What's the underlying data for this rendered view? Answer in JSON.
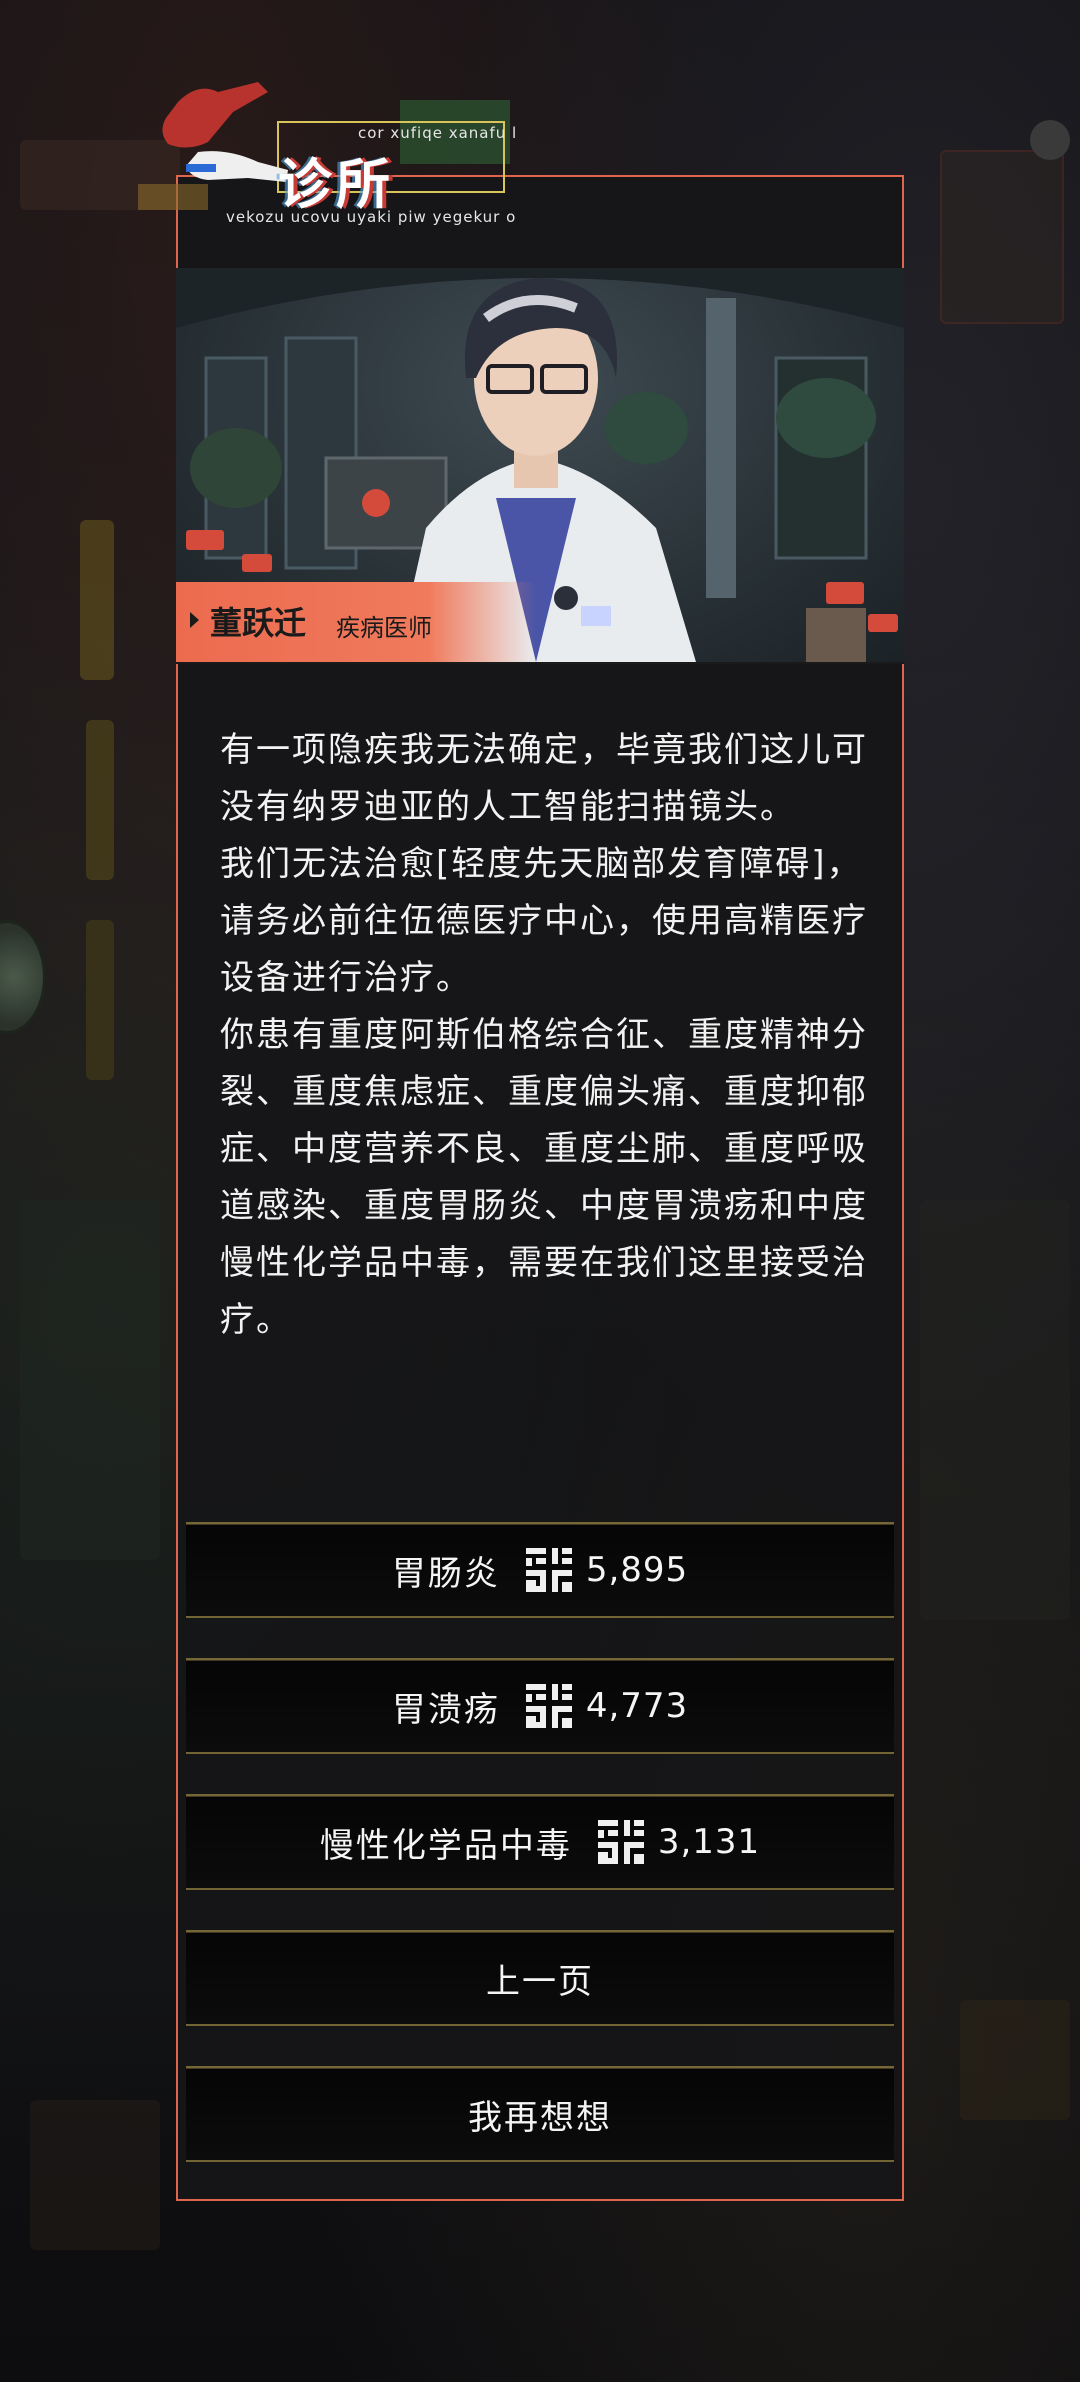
{
  "header": {
    "title": "诊所",
    "subtitle_top": "cor xufiqe xanafu l",
    "subtitle_bottom": "vekozu ucovu uyaki piw yegekur o"
  },
  "npc": {
    "name": "董跃迁",
    "role": "疾病医师"
  },
  "dialogue": {
    "paragraphs": [
      "有一项隐疾我无法确定，毕竟我们这儿可没有纳罗迪亚的人工智能扫描镜头。",
      "我们无法治愈[轻度先天脑部发育障碍]，请务必前往伍德医疗中心，使用高精医疗设备进行治疗。",
      "你患有重度阿斯伯格综合征、重度精神分裂、重度焦虑症、重度偏头痛、重度抑郁症、中度营养不良、重度尘肺、重度呼吸道感染、重度胃肠炎、中度胃溃疡和中度慢性化学品中毒，需要在我们这里接受治疗。"
    ]
  },
  "options": [
    {
      "label": "胃肠炎",
      "price": "5,895",
      "icon": "currency-icon"
    },
    {
      "label": "胃溃疡",
      "price": "4,773",
      "icon": "currency-icon"
    },
    {
      "label": "慢性化学品中毒",
      "price": "3,131",
      "icon": "currency-icon"
    },
    {
      "label": "上一页"
    },
    {
      "label": "我再想想"
    }
  ],
  "colors": {
    "accent": "#e0654f",
    "name_bar": "#ec6b4f",
    "option_border": "#cdb45a",
    "text": "#f2f2f2"
  }
}
